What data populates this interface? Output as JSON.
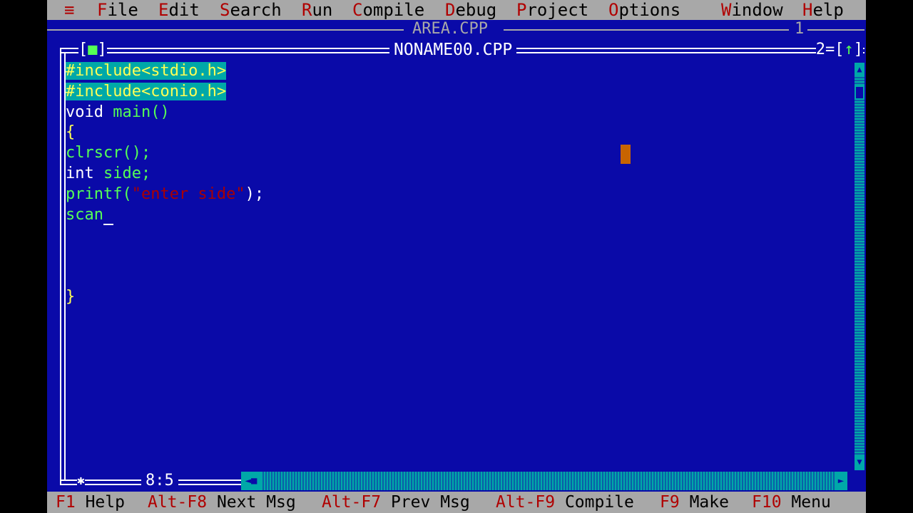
{
  "menu": {
    "system": "≡",
    "items": [
      {
        "hot": "F",
        "rest": "ile"
      },
      {
        "hot": "E",
        "rest": "dit"
      },
      {
        "hot": "S",
        "rest": "earch"
      },
      {
        "hot": "R",
        "rest": "un"
      },
      {
        "hot": "C",
        "rest": "ompile"
      },
      {
        "hot": "D",
        "rest": "ebug"
      },
      {
        "hot": "P",
        "rest": "roject"
      },
      {
        "hot": "O",
        "rest": "ptions"
      },
      {
        "hot": "W",
        "rest": "indow"
      },
      {
        "hot": "H",
        "rest": "elp"
      }
    ]
  },
  "background_window": {
    "title": "AREA.CPP",
    "number": "1"
  },
  "editor": {
    "title": "NONAME00.CPP",
    "close_box": "[■]",
    "window_number": "2",
    "zoom_box": "[↑]",
    "cursor_position": "8:5",
    "code": {
      "line1": "#include<stdio.h>",
      "line2": "#include<conio.h>",
      "line3_kw": "void",
      "line3_fn": "main()",
      "line4": "{",
      "line5": "clrscr();",
      "line6_kw": "int",
      "line6_rest": "side;",
      "line7_fn": "printf(",
      "line7_str": "\"enter side\"",
      "line7_end": ");",
      "line8": "scan",
      "line_close": "}"
    }
  },
  "status": [
    {
      "key": "F1",
      "label": "Help"
    },
    {
      "key": "Alt-F8",
      "label": "Next Msg"
    },
    {
      "key": "Alt-F7",
      "label": "Prev Msg"
    },
    {
      "key": "Alt-F9",
      "label": "Compile"
    },
    {
      "key": "F9",
      "label": "Make"
    },
    {
      "key": "F10",
      "label": "Menu"
    }
  ],
  "colors": {
    "background": "#0a0aa8",
    "menu": "#a8a8a8",
    "hotkey": "#b00000",
    "selection": "#00a8a8"
  }
}
